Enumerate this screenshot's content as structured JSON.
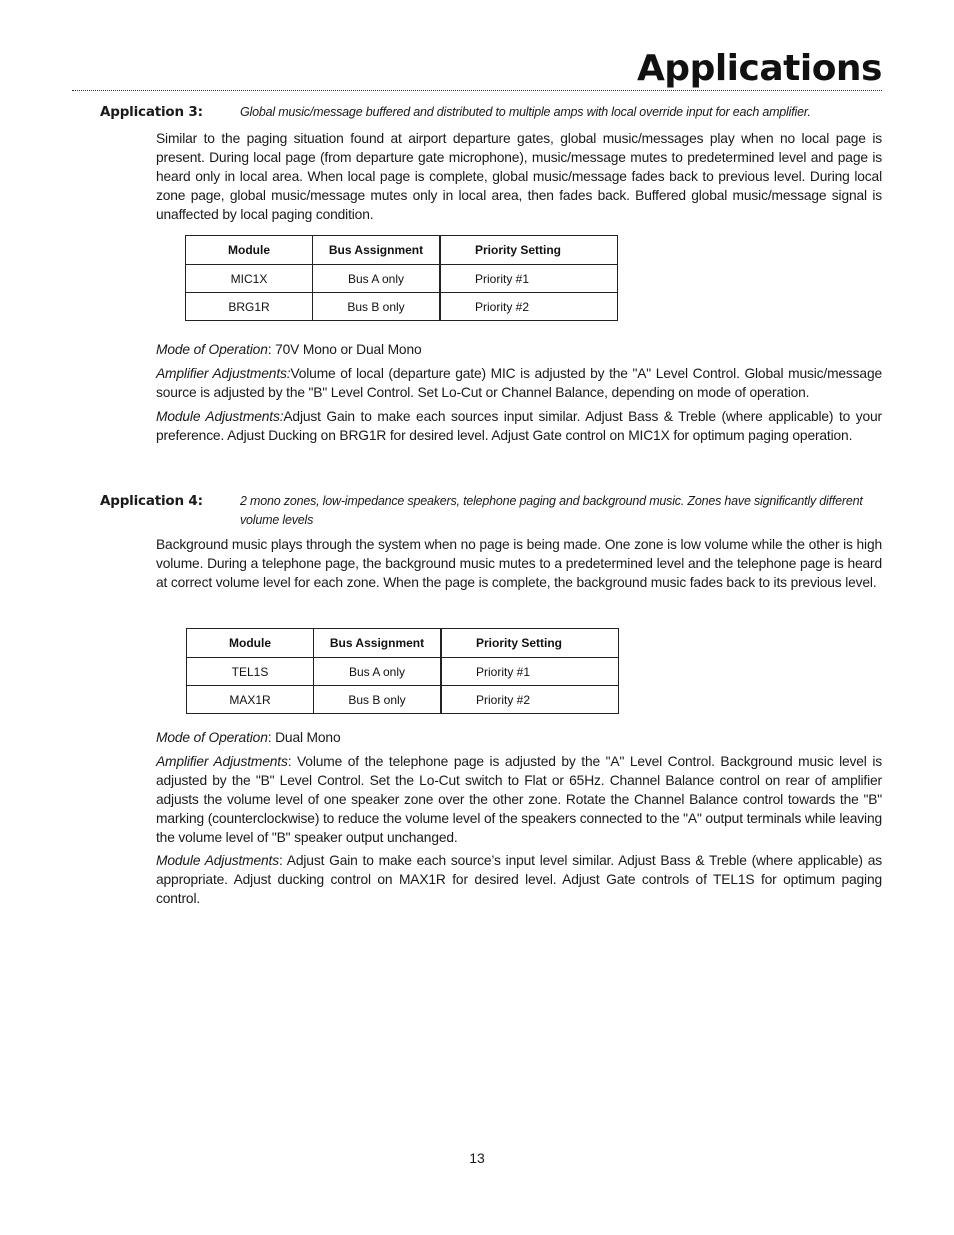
{
  "page": {
    "title": "Applications",
    "page_number": "13"
  },
  "app3": {
    "label": "Application 3:",
    "description": "Global music/message buffered and distributed to multiple amps with local override input for each amplifier.",
    "body": "Similar to the paging situation found at airport departure gates, global music/messages play when no local page is present. During local page (from departure gate microphone), music/message mutes to predetermined level and page is heard only in local area.  When local page is complete, global music/message fades back to previous level. During local zone page, global music/message mutes only in local area, then fades back. Buffered global music/message signal is unaffected by local paging condition.",
    "table": {
      "headers": [
        "Module",
        "Bus Assignment",
        "Priority Setting"
      ],
      "rows": [
        [
          "MIC1X",
          "Bus A only",
          "Priority #1"
        ],
        [
          "BRG1R",
          "Bus B only",
          "Priority #2"
        ]
      ]
    },
    "mode_label": "Mode of Operation",
    "mode_value": ": 70V Mono or Dual Mono",
    "amp_label": "Amplifier Adjustments:",
    "amp_text": "Volume of local (departure gate) MIC is adjusted by the \"A\" Level Control. Global music/message source is adjusted by the \"B\" Level Control. Set Lo-Cut or Channel Balance, depending on mode of operation.",
    "module_label": "Module Adjustments:",
    "module_text": "Adjust Gain to make each sources input similar.  Adjust Bass & Treble (where applicable) to your preference. Adjust Ducking on BRG1R for desired level.  Adjust Gate control on MIC1X for optimum paging operation."
  },
  "app4": {
    "label": "Application 4:",
    "description": "2 mono zones, low-impedance speakers, telephone paging and background music. Zones have significantly different volume levels",
    "body": "Background music plays through the system when no page is being made. One zone is low volume while the other is high volume. During a telephone page, the background music mutes to a predetermined level and the telephone page is heard at correct volume level for each zone. When the page is complete, the background music fades back to its previous level.",
    "table": {
      "headers": [
        "Module",
        "Bus Assignment",
        "Priority Setting"
      ],
      "rows": [
        [
          "TEL1S",
          "Bus A only",
          "Priority #1"
        ],
        [
          "MAX1R",
          "Bus B only",
          "Priority #2"
        ]
      ]
    },
    "mode_label": "Mode of Operation",
    "mode_value": ": Dual Mono",
    "amp_label": "Amplifier Adjustments",
    "amp_text": ":  Volume of the telephone page is adjusted by the \"A\" Level Control. Background music level is adjusted by the \"B\" Level Control. Set the Lo-Cut switch to Flat or 65Hz. Channel Balance control on rear of amplifier adjusts the volume level of one speaker zone over the other zone. Rotate the Channel Balance control towards the \"B\" marking (counterclockwise) to reduce the volume level of the speakers connected to the \"A\" output terminals while leaving the volume level of \"B\" speaker output unchanged.",
    "module_label": "Module Adjustments",
    "module_text": ":  Adjust Gain to make each source’s input level similar. Adjust Bass & Treble (where applicable) as appropriate. Adjust ducking control on MAX1R for desired level.  Adjust Gate controls of TEL1S for optimum paging control."
  }
}
